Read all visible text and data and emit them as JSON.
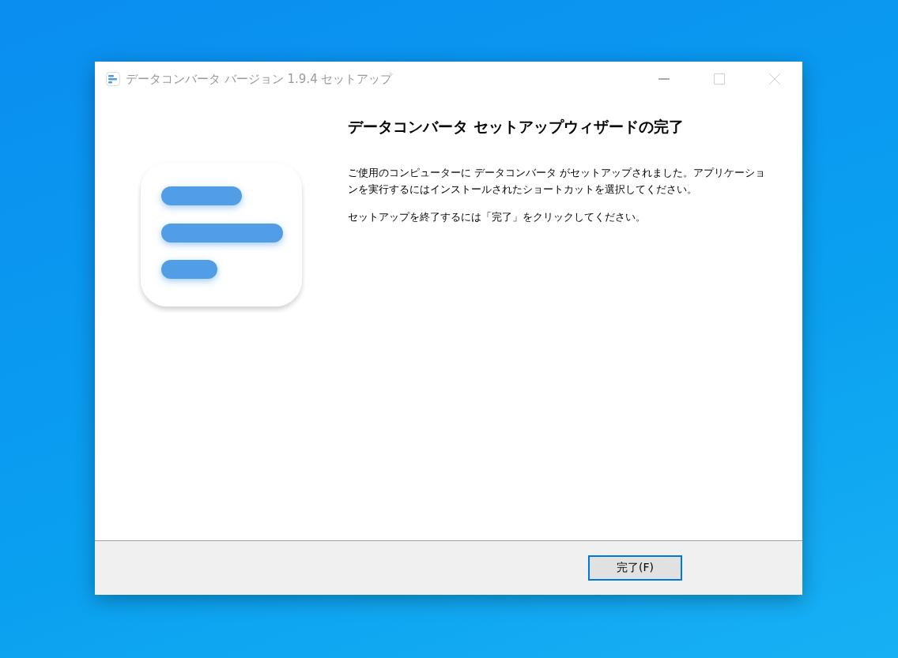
{
  "window": {
    "title": "データコンバータ バージョン 1.9.4 セットアップ",
    "controls": [
      {
        "kind": "minimize",
        "disabled": false
      },
      {
        "kind": "maximize",
        "disabled": true
      },
      {
        "kind": "close",
        "disabled": true
      }
    ]
  },
  "heading": "データコンバータ セットアップウィザードの完了",
  "paragraphs": [
    "ご使用のコンピューターに データコンバータ がセットアップされました。アプリケーションを実行するにはインストールされたショートカットを選択してください。",
    "セットアップを終了するには「完了」をクリックしてください。"
  ],
  "buttons": [
    {
      "label": "完了(F)",
      "focused": true
    }
  ]
}
